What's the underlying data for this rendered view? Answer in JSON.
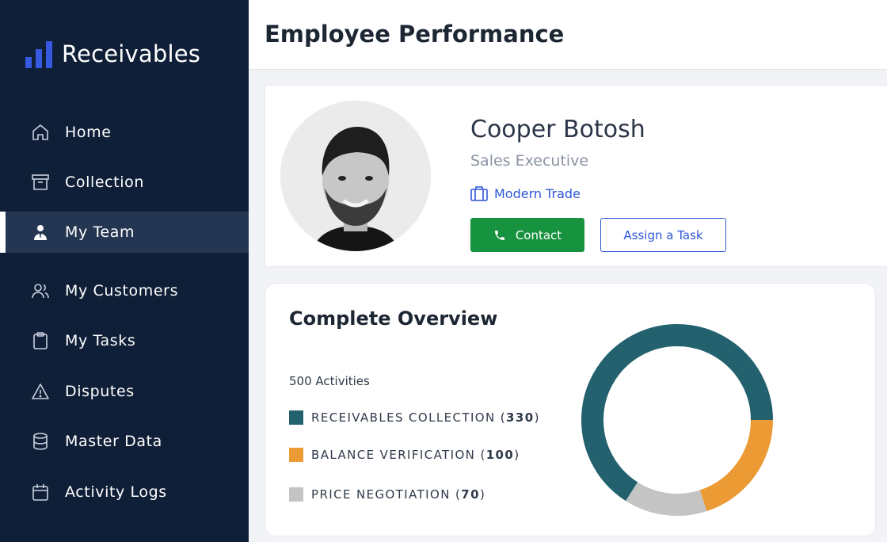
{
  "app": {
    "brand": "Receivables"
  },
  "sidebar": {
    "items": [
      {
        "label": "Home",
        "icon": "home-icon"
      },
      {
        "label": "Collection",
        "icon": "archive-box-icon"
      },
      {
        "label": "My Team",
        "icon": "team-member-icon",
        "active": true
      },
      {
        "label": "My Customers",
        "icon": "users-icon"
      },
      {
        "label": "My Tasks",
        "icon": "clipboard-icon"
      },
      {
        "label": "Disputes",
        "icon": "warning-triangle-icon"
      },
      {
        "label": "Master Data",
        "icon": "database-icon"
      },
      {
        "label": "Activity Logs",
        "icon": "calendar-icon"
      }
    ]
  },
  "header": {
    "title": "Employee Performance"
  },
  "profile": {
    "name": "Cooper Botosh",
    "role": "Sales Executive",
    "department": "Modern Trade",
    "contact_label": "Contact",
    "assign_label": "Assign a Task"
  },
  "overview": {
    "title": "Complete Overview",
    "activities_label": "500 Activities",
    "legend": [
      {
        "label": "RECEIVABLES COLLECTION (",
        "count": "330",
        "suffix": ")",
        "color": "#24616f"
      },
      {
        "label": "BALANCE VERIFICATION (",
        "count": "100",
        "suffix": ")",
        "color": "#ec9a33"
      },
      {
        "label": "PRICE NEGOTIATION (",
        "count": "70",
        "suffix": ")",
        "color": "#c4c4c4"
      }
    ]
  },
  "chart_data": {
    "type": "pie",
    "categories": [
      "Receivables Collection",
      "Balance Verification",
      "Price Negotiation"
    ],
    "values": [
      330,
      100,
      70
    ],
    "colors": [
      "#24616f",
      "#ec9a33",
      "#c4c4c4"
    ]
  }
}
